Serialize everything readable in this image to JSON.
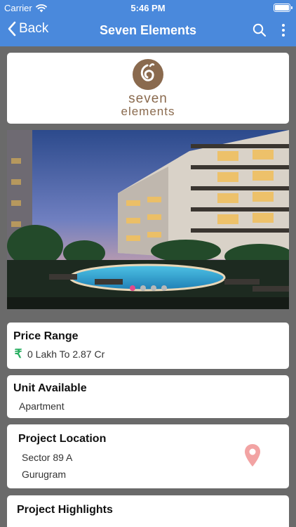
{
  "status_bar": {
    "carrier": "Carrier",
    "time": "5:46 PM"
  },
  "nav": {
    "back_label": "Back",
    "title": "Seven Elements"
  },
  "logo": {
    "line1": "seven",
    "line2": "elements",
    "color": "#8a6a4e"
  },
  "gallery": {
    "slide_count": 4,
    "active_index": 0
  },
  "price": {
    "label": "Price Range",
    "currency_icon": "rupee-icon",
    "value": "0 Lakh To 2.87 Cr"
  },
  "unit": {
    "label": "Unit Available",
    "value": "Apartment"
  },
  "location": {
    "label": "Project Location",
    "line1": "Sector 89 A",
    "line2": "Gurugram",
    "pin_color": "#f2a3a3"
  },
  "highlights": {
    "label": "Project Highlights"
  },
  "colors": {
    "brand": "#4a89dc",
    "accent_dot": "#e24a8b",
    "rupee": "#27ae60"
  }
}
